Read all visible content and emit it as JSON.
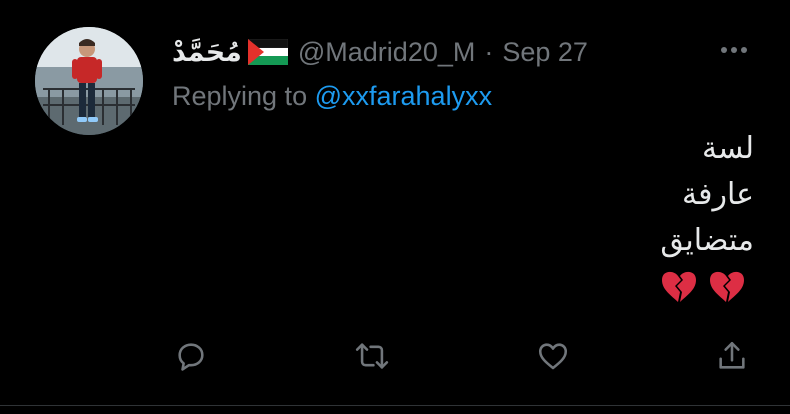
{
  "tweet": {
    "author": {
      "display_name": "مُحَمَّدْ",
      "flag_icon": "palestine-flag-icon",
      "handle": "@Madrid20_M",
      "separator": "·",
      "date": "Sep 27"
    },
    "replying_prefix": "Replying to",
    "replying_to": "@xxfarahalyxx",
    "body_lines": [
      "لسة",
      "عارفة",
      "متضايق"
    ],
    "emoji_icons": [
      "broken-heart-icon",
      "broken-heart-icon"
    ],
    "actions": {
      "reply_icon": "reply-icon",
      "retweet_icon": "retweet-icon",
      "like_icon": "heart-icon",
      "share_icon": "share-icon"
    }
  },
  "colors": {
    "background": "#000000",
    "text_primary": "#e7e9ea",
    "text_secondary": "#71767b",
    "accent": "#1d9bf0",
    "broken_heart": "#e0245e"
  }
}
